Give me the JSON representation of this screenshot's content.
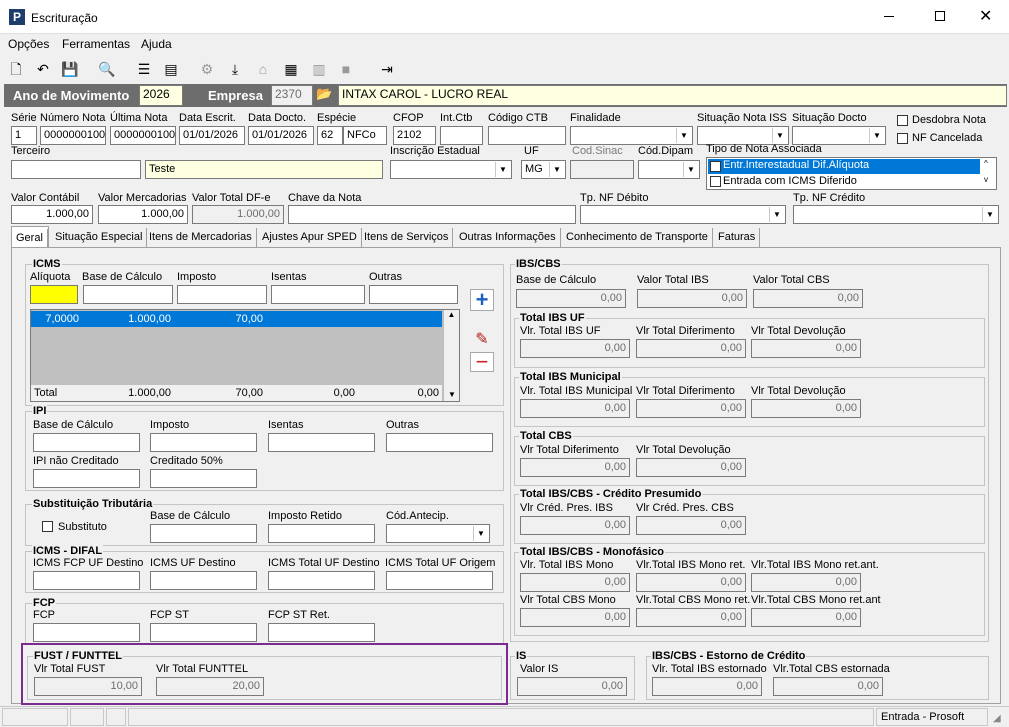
{
  "window": {
    "title": "Escrituração",
    "logo": "P"
  },
  "menu": [
    "Opções",
    "Ferramentas",
    "Ajuda"
  ],
  "header": {
    "ano_label": "Ano de Movimento",
    "ano": "2026",
    "empresa_label": "Empresa",
    "empresa_code": "2370",
    "empresa_name": "INTAX CAROL - LUCRO REAL"
  },
  "row1": {
    "serie_l": "Série",
    "serie": "1",
    "num_l": "Número Nota",
    "num": "0000000100",
    "ult_l": "Última Nota",
    "ult": "0000000100",
    "descr_l": "Data Escrit.",
    "descr": "01/01/2026",
    "ddoc_l": "Data Docto.",
    "ddoc": "01/01/2026",
    "esp_l": "Espécie",
    "esp_num": "62",
    "esp": "NFCo",
    "cfop_l": "CFOP",
    "cfop": "2102",
    "intctb_l": "Int.Ctb",
    "codctb_l": "Código CTB",
    "fin_l": "Finalidade",
    "sitiss_l": "Situação Nota ISS",
    "sitdoc_l": "Situação Docto",
    "desdobra": "Desdobra Nota",
    "cancel": "NF Cancelada"
  },
  "row2": {
    "terc_l": "Terceiro",
    "terc_name": "Teste",
    "ie_l": "Inscrição Estadual",
    "uf_l": "UF",
    "uf": "MG",
    "sinac_l": "Cod.Sinac",
    "dipam_l": "Cód.Dipam",
    "tipo_l": "Tipo de Nota Associada",
    "tipo_items": [
      "Entr.Interestadual Dif.Alíquota",
      "Entrada com ICMS Diferido"
    ]
  },
  "row3": {
    "vcont_l": "Valor Contábil",
    "vcont": "1.000,00",
    "vmerc_l": "Valor Mercadorias",
    "vmerc": "1.000,00",
    "vdfe_l": "Valor Total DF-e",
    "vdfe": "1.000,00",
    "chave_l": "Chave da Nota",
    "tpdeb_l": "Tp. NF Débito",
    "tpcred_l": "Tp. NF Crédito"
  },
  "tabs": [
    "Geral",
    "Situação Especial",
    "Itens de Mercadorias",
    "Ajustes Apur SPED",
    "Itens de Serviços",
    "Outras Informações",
    "Conhecimento de Transporte",
    "Faturas"
  ],
  "icms": {
    "title": "ICMS",
    "cols": [
      "Alíquota",
      "Base de Cálculo",
      "Imposto",
      "Isentas",
      "Outras"
    ],
    "row": [
      "7,0000",
      "1.000,00",
      "70,00",
      "",
      ""
    ],
    "total_l": "Total",
    "total": [
      "1.000,00",
      "70,00",
      "0,00",
      "0,00"
    ]
  },
  "ipi": {
    "title": "IPI",
    "l1": "Base de Cálculo",
    "l2": "Imposto",
    "l3": "Isentas",
    "l4": "Outras",
    "l5": "IPI não Creditado",
    "l6": "Creditado 50%"
  },
  "st": {
    "title": "Substituição Tributária",
    "chk": "Substituto",
    "l1": "Base de Cálculo",
    "l2": "Imposto Retido",
    "l3": "Cód.Antecip."
  },
  "difal": {
    "title": "ICMS - DIFAL",
    "l1": "ICMS FCP UF Destino",
    "l2": "ICMS UF Destino",
    "l3": "ICMS Total UF Destino",
    "l4": "ICMS Total UF Origem"
  },
  "fcp": {
    "title": "FCP",
    "l1": "FCP",
    "l2": "FCP ST",
    "l3": "FCP ST Ret."
  },
  "fust": {
    "title": "FUST / FUNTTEL",
    "l1": "Vlr Total FUST",
    "v1": "10,00",
    "l2": "Vlr Total FUNTTEL",
    "v2": "20,00"
  },
  "ibs": {
    "title": "IBS/CBS",
    "l1": "Base de Cálculo",
    "l2": "Valor Total IBS",
    "l3": "Valor Total CBS",
    "v": "0,00",
    "uf_t": "Total IBS UF",
    "uf_l": [
      "Vlr. Total IBS UF",
      "Vlr Total Diferimento",
      "Vlr Total Devolução"
    ],
    "mun_t": "Total IBS Municipal",
    "mun_l": [
      "Vlr. Total IBS Municipal",
      "Vlr Total Diferimento",
      "Vlr Total Devolução"
    ],
    "cbs_t": "Total CBS",
    "cbs_l": [
      "Vlr Total Diferimento",
      "Vlr Total Devolução"
    ],
    "cp_t": "Total IBS/CBS - Crédito Presumido",
    "cp_l": [
      "Vlr Créd. Pres. IBS",
      "Vlr Créd. Pres. CBS"
    ],
    "mono_t": "Total IBS/CBS - Monofásico",
    "mono_l": [
      "Vlr. Total IBS Mono",
      "Vlr.Total IBS Mono ret.",
      "Vlr.Total IBS Mono ret.ant.",
      "Vlr Total CBS Mono",
      "Vlr.Total CBS Mono ret.",
      "Vlr.Total CBS Mono ret.ant"
    ]
  },
  "is": {
    "title": "IS",
    "l1": "Valor IS",
    "v1": "0,00"
  },
  "estorno": {
    "title": "IBS/CBS - Estorno de Crédito",
    "l1": "Vlr. Total IBS estornado",
    "l2": "Vlr.Total CBS estornada",
    "v": "0,00"
  },
  "status": {
    "right": "Entrada - Prosoft"
  },
  "colors": {
    "highlight": "#0078d7",
    "fust_border": "#7b2b8f",
    "header_bg": "#6d6d6d"
  }
}
